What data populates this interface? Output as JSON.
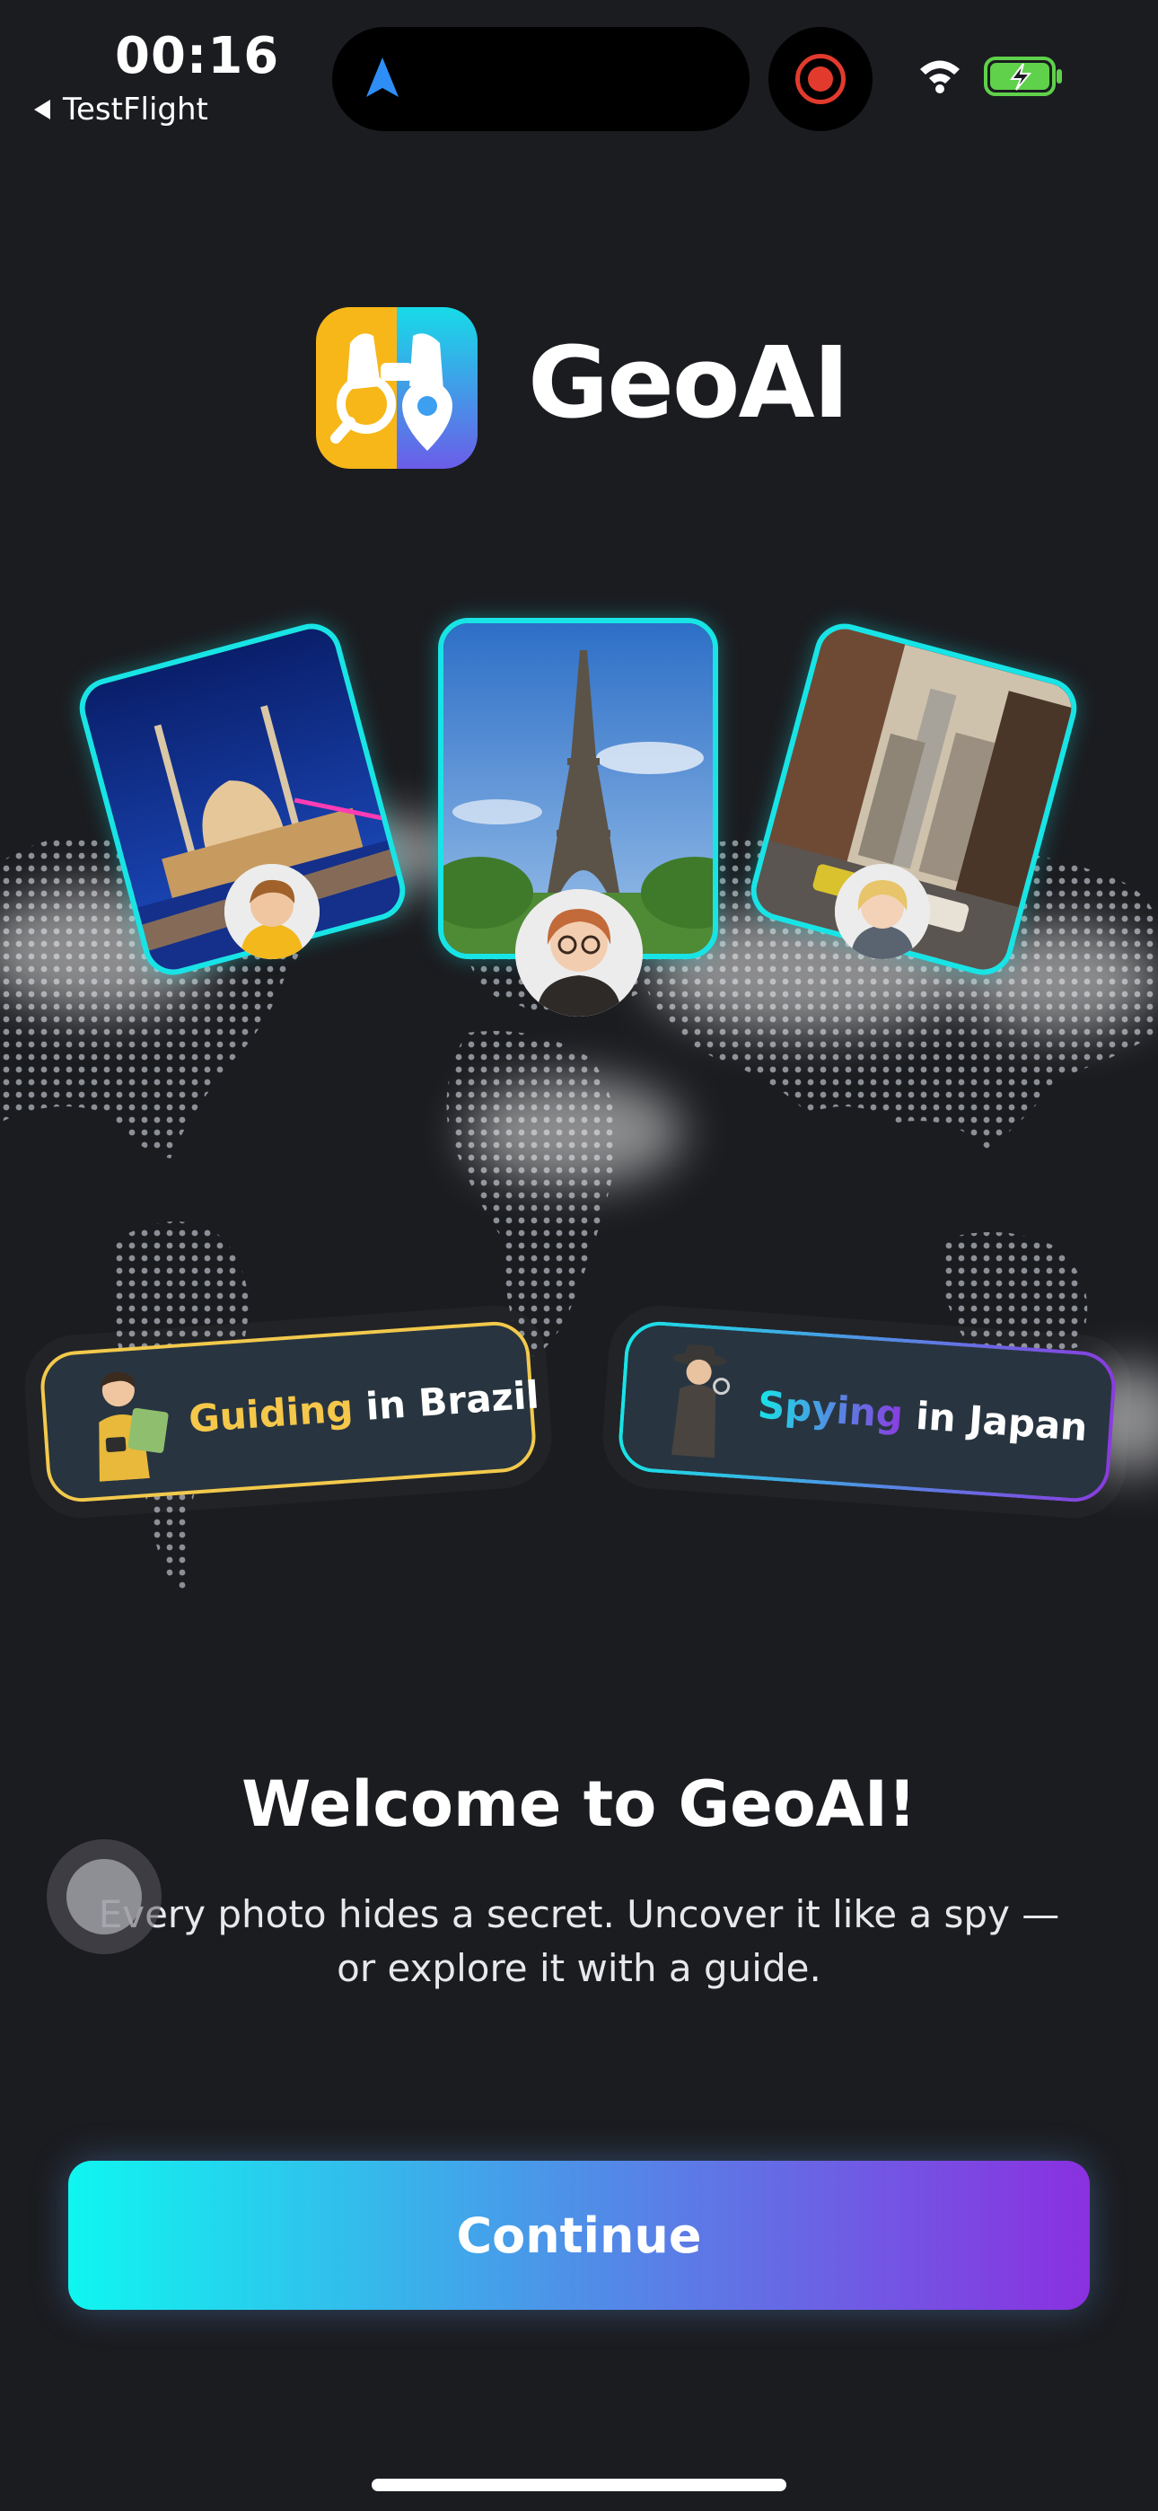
{
  "status_bar": {
    "time": "00:16",
    "back_label": "TestFlight",
    "icons": [
      "navigation-arrow-icon",
      "screen-recording-icon",
      "wifi-icon",
      "battery-charging-icon"
    ]
  },
  "header": {
    "app_name": "GeoAI"
  },
  "photo_cards": [
    {
      "scene": "mosque-at-night"
    },
    {
      "scene": "eiffel-tower"
    },
    {
      "scene": "city-street"
    }
  ],
  "personas": {
    "brazil": {
      "keyword": "Guiding",
      "rest": " in Brazil"
    },
    "japan": {
      "keyword": "Spying",
      "rest": " in Japan"
    }
  },
  "welcome": {
    "title": "Welcome to GeoAI!",
    "subtitle": "Every photo hides a secret. Uncover it like a spy — or explore it with a guide."
  },
  "actions": {
    "continue_label": "Continue"
  },
  "colors": {
    "background": "#1b1c20",
    "accent_cyan": "#18e4e6",
    "accent_purple": "#8a30e0",
    "accent_yellow": "#f5c74a"
  }
}
